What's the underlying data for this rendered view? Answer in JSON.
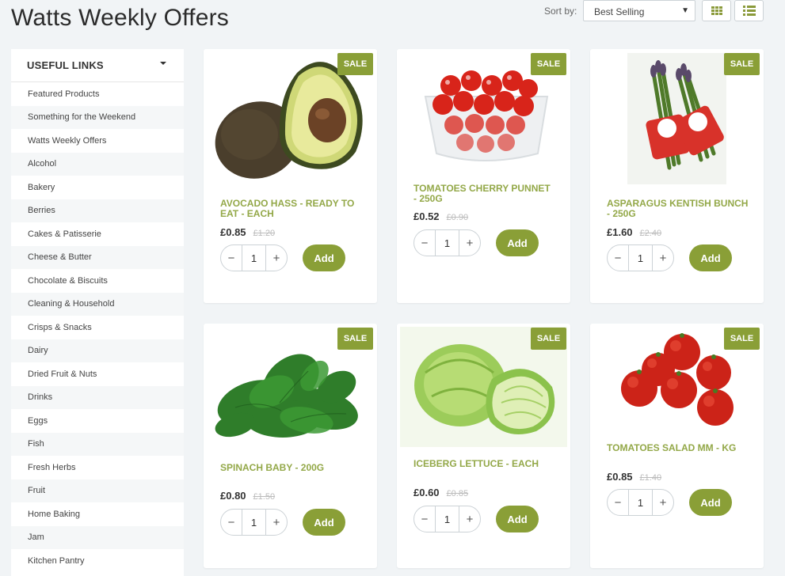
{
  "page": {
    "title": "Watts Weekly Offers"
  },
  "toolbar": {
    "sort_label": "Sort by:",
    "sort_value": "Best Selling",
    "grid_view_icon": "grid-icon",
    "list_view_icon": "list-icon"
  },
  "sidebar": {
    "header": "USEFUL LINKS",
    "items": [
      "Featured Products",
      "Something for the Weekend",
      "Watts Weekly Offers",
      "Alcohol",
      "Bakery",
      "Berries",
      "Cakes & Patisserie",
      "Cheese & Butter",
      "Chocolate & Biscuits",
      "Cleaning & Household",
      "Crisps & Snacks",
      "Dairy",
      "Dried Fruit & Nuts",
      "Drinks",
      "Eggs",
      "Fish",
      "Fresh Herbs",
      "Fruit",
      "Home Baking",
      "Jam",
      "Kitchen Pantry"
    ]
  },
  "products": [
    {
      "name": "AVOCADO HASS - READY TO EAT - EACH",
      "price": "£0.85",
      "old_price": "£1.20",
      "badge": "SALE",
      "qty": "1",
      "add_label": "Add"
    },
    {
      "name": "TOMATOES CHERRY PUNNET - 250G",
      "price": "£0.52",
      "old_price": "£0.90",
      "badge": "SALE",
      "qty": "1",
      "add_label": "Add"
    },
    {
      "name": "ASPARAGUS KENTISH BUNCH - 250G",
      "price": "£1.60",
      "old_price": "£2.40",
      "badge": "SALE",
      "qty": "1",
      "add_label": "Add"
    },
    {
      "name": "SPINACH BABY - 200G",
      "price": "£0.80",
      "old_price": "£1.50",
      "badge": "SALE",
      "qty": "1",
      "add_label": "Add"
    },
    {
      "name": "ICEBERG LETTUCE - EACH",
      "price": "£0.60",
      "old_price": "£0.85",
      "badge": "SALE",
      "qty": "1",
      "add_label": "Add"
    },
    {
      "name": "TOMATOES SALAD MM - KG",
      "price": "£0.85",
      "old_price": "£1.40",
      "badge": "SALE",
      "qty": "1",
      "add_label": "Add"
    }
  ],
  "colors": {
    "accent": "#8a9f37",
    "product_name": "#93a848",
    "background": "#f1f4f6"
  }
}
